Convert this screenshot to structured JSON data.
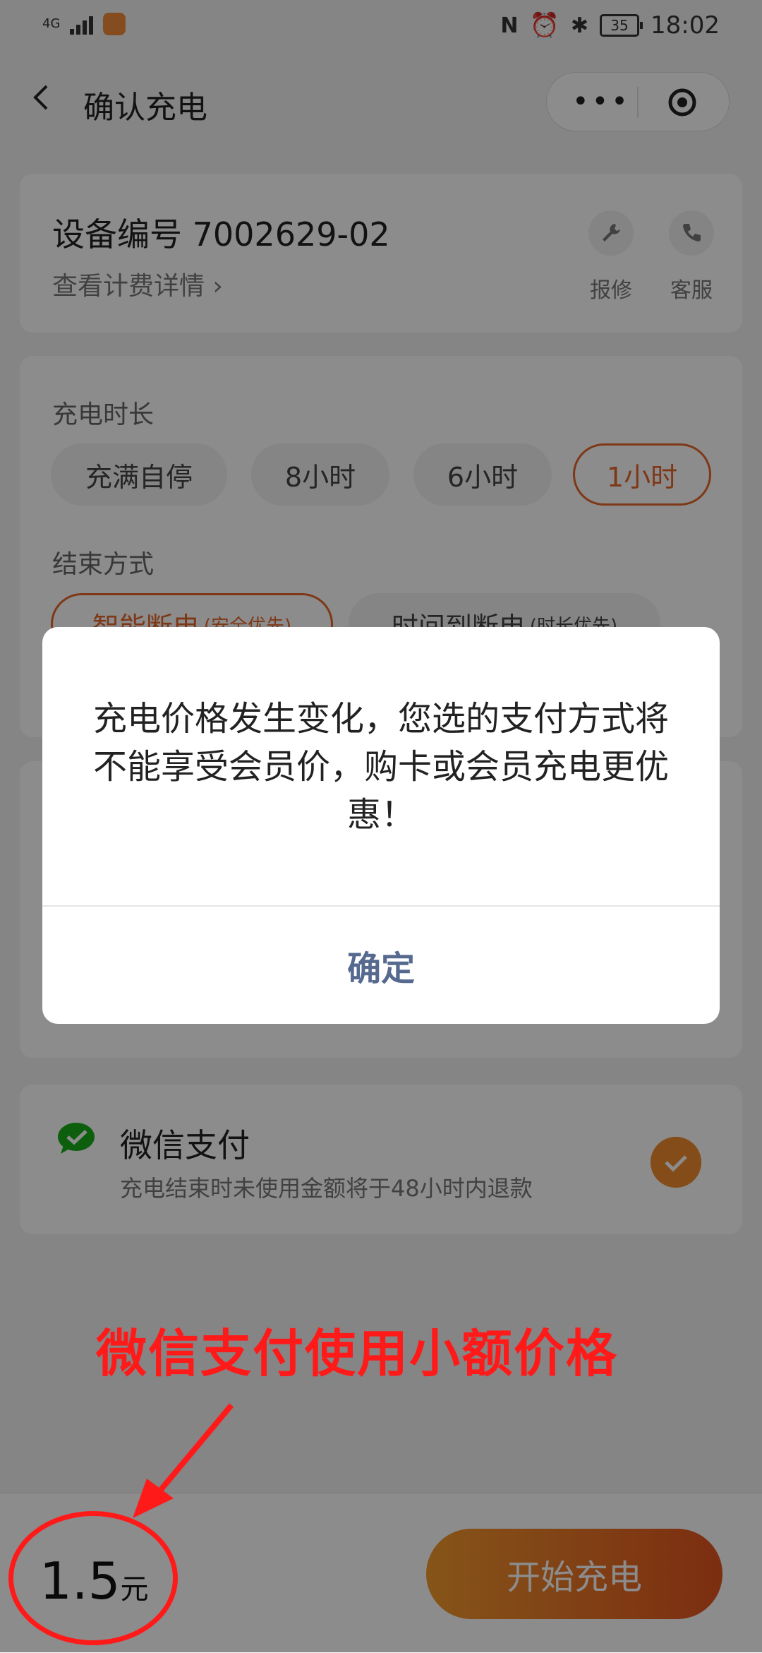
{
  "status_bar": {
    "network": "4G",
    "battery": "35",
    "time": "18:02"
  },
  "nav": {
    "title": "确认充电",
    "capsule_more": "•••"
  },
  "device_card": {
    "device_id": "设备编号 7002629-02",
    "billing_link": "查看计费详情 ›",
    "repair_label": "报修",
    "service_label": "客服"
  },
  "options_card": {
    "duration_label": "充电时长",
    "duration_options": [
      "充满自停",
      "8小时",
      "6小时",
      "1小时"
    ],
    "duration_selected": "1小时",
    "end_label": "结束方式",
    "end_options": [
      {
        "label": "智能断电",
        "note": "(安全优先)"
      },
      {
        "label": "时间到断电",
        "note": "(时长优先)"
      }
    ],
    "end_selected": "智能断电"
  },
  "payment_card": {
    "method": "微信支付",
    "note": "充电结束时未使用金额将于48小时内退款",
    "selected": true
  },
  "bottom_bar": {
    "price": "1.5",
    "unit": "元",
    "start_button": "开始充电"
  },
  "modal": {
    "message": "充电价格发生变化，您选的支付方式将不能享受会员价，购卡或会员充电更优惠！",
    "confirm": "确定"
  },
  "annotation": {
    "text": "微信支付使用小额价格"
  },
  "colors": {
    "accent": "#e5672a",
    "wechat_green": "#1aad19",
    "annotation_red": "#ff1a1a",
    "modal_button": "#56698f"
  }
}
